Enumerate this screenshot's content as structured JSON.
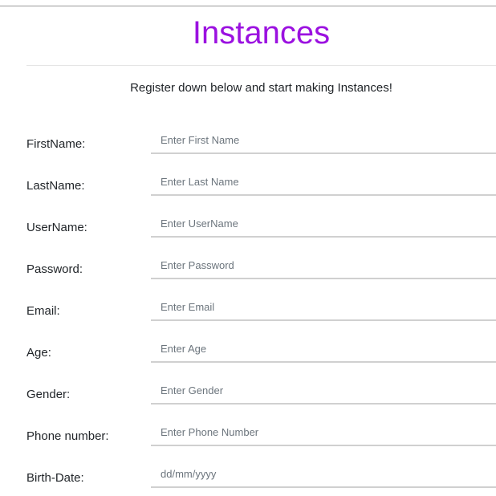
{
  "header": {
    "title": "Instances",
    "subtitle": "Register down below and start making Instances!"
  },
  "colors": {
    "accent": "#9b11e0"
  },
  "form": {
    "fields": [
      {
        "label": "FirstName:",
        "placeholder": "Enter First Name"
      },
      {
        "label": "LastName:",
        "placeholder": "Enter Last Name"
      },
      {
        "label": "UserName:",
        "placeholder": "Enter UserName"
      },
      {
        "label": "Password:",
        "placeholder": "Enter Password"
      },
      {
        "label": "Email:",
        "placeholder": "Enter Email"
      },
      {
        "label": "Age:",
        "placeholder": "Enter Age"
      },
      {
        "label": "Gender:",
        "placeholder": "Enter Gender"
      },
      {
        "label": "Phone number:",
        "placeholder": "Enter Phone Number"
      },
      {
        "label": "Birth-Date:",
        "placeholder": "dd/mm/yyyy"
      }
    ]
  }
}
